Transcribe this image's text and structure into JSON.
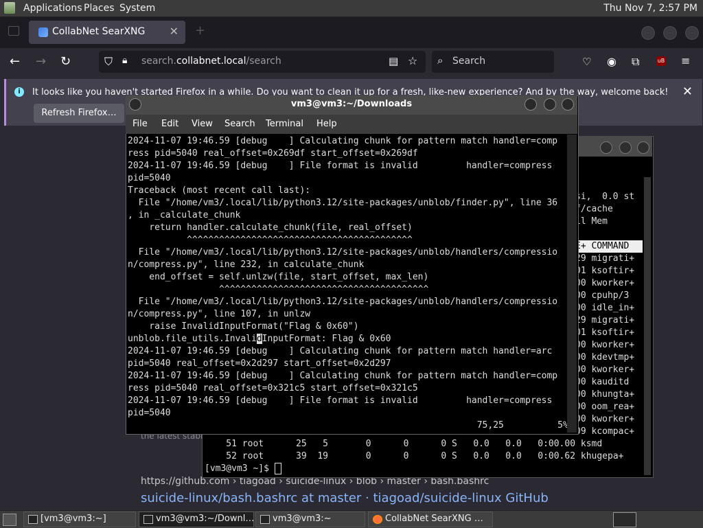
{
  "top_panel": {
    "menus": [
      "Applications",
      "Places",
      "System"
    ],
    "clock": "Thu Nov  7,  2:57 PM"
  },
  "firefox": {
    "tab_title": "CollabNet SearXNG",
    "url_prefix": "search.",
    "url_host": "collabnet.local",
    "url_path": "/search",
    "search_placeholder": "Search",
    "notification": "It looks like you haven't started Firefox in a while. Do you want to clean it up for a fresh, like-new experience? And by the way, welcome back!",
    "refresh_button": "Refresh Firefox…",
    "page": {
      "snippet_fragment": "the latest stable",
      "result_url": "https://github.com  › tiagoad › suicide-linux › blob › master › bash.bashrc",
      "result_title": "suicide-linux/bash.bashrc at master · tiagoad/suicide-linux GitHub"
    }
  },
  "front_terminal": {
    "title": "vm3@vm3:~/Downloads",
    "menu": [
      "File",
      "Edit",
      "View",
      "Search",
      "Terminal",
      "Help"
    ],
    "lines_before_cursor": "2024-11-07 19:46.59 [debug    ] Calculating chunk for pattern match handler=comp\nress pid=5040 real_offset=0x269df start_offset=0x269df\n2024-11-07 19:46.59 [debug    ] File format is invalid         handler=compress\npid=5040\nTraceback (most recent call last):\n  File \"/home/vm3/.local/lib/python3.12/site-packages/unblob/finder.py\", line 36\n, in _calculate_chunk\n    return handler.calculate_chunk(file, real_offset)\n           ^^^^^^^^^^^^^^^^^^^^^^^^^^^^^^^^^^^^^^^^^^\n  File \"/home/vm3/.local/lib/python3.12/site-packages/unblob/handlers/compressio\nn/compress.py\", line 232, in calculate_chunk\n    end_offset = self.unlzw(file, start_offset, max_len)\n                 ^^^^^^^^^^^^^^^^^^^^^^^^^^^^^^^^^^^^^^^\n  File \"/home/vm3/.local/lib/python3.12/site-packages/unblob/handlers/compressio\nn/compress.py\", line 107, in unlzw\n    raise InvalidInputFormat(\"Flag & 0x60\")\nunblob.file_utils.Invali",
    "cursor_char": "d",
    "lines_after_cursor": "InputFormat: Flag & 0x60\n2024-11-07 19:46.59 [debug    ] Calculating chunk for pattern match handler=arc\npid=5040 real_offset=0x2d297 start_offset=0x2d297\n2024-11-07 19:46.59 [debug    ] Calculating chunk for pattern match handler=comp\nress pid=5040 real_offset=0x321c5 start_offset=0x321c5\n2024-11-07 19:46.59 [debug    ] File format is invalid         handler=compress\npid=5040",
    "status_line": "                                                                 75,25          5%"
  },
  "back_terminal": {
    "right_column": "si,  0.0 st\nf/cache\nil Mem",
    "header": "E+ COMMAND",
    "processes_right": "29 migrati+\n01 ksoftir+\n00 kworker+\n00 cpuhp/3\n00 idle_in+\n29 migrati+\n01 ksoftir+\n00 kworker+\n00 kdevtmp+\n00 kworker+\n00 kauditd\n00 khungta+\n00 oom_rea+\n00 kworker+\n09 kcompac+",
    "bottom_rows": "    51 root      25   5       0      0      0 S   0.0   0.0   0:00.00 ksmd\n    52 root      39  19       0      0      0 S   0.0   0.0   0:00.62 khugepa+",
    "prompt": "[vm3@vm3 ~]$ "
  },
  "taskbar": {
    "items": [
      "[vm3@vm3:~]",
      "vm3@vm3:~/Downl…",
      "vm3@vm3:~",
      "CollabNet SearXNG …"
    ]
  }
}
